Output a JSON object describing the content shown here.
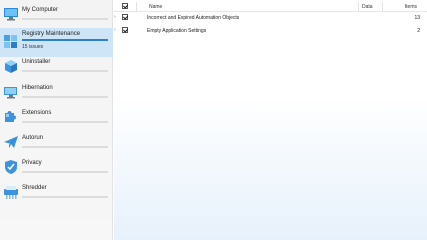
{
  "sidebar": {
    "items": [
      {
        "label": "My Computer",
        "icon": "computer-icon"
      },
      {
        "label": "Registry Maintenance",
        "icon": "registry-cubes-icon",
        "sub": "15 issues"
      },
      {
        "label": "Uninstaller",
        "icon": "uninstaller-box-icon"
      },
      {
        "label": "Hibernation",
        "icon": "hibernation-monitor-icon"
      },
      {
        "label": "Extensions",
        "icon": "puzzle-icon"
      },
      {
        "label": "Autorun",
        "icon": "paper-plane-icon"
      },
      {
        "label": "Privacy",
        "icon": "shield-icon"
      },
      {
        "label": "Shredder",
        "icon": "shredder-icon"
      }
    ]
  },
  "table": {
    "columns": {
      "name": "Name",
      "data": "Data",
      "items": "Items"
    },
    "rows": [
      {
        "name": "Incorrect and Expired Automation Objects",
        "items": "13"
      },
      {
        "name": "Empty Application Settings",
        "items": "2"
      }
    ]
  },
  "colors": {
    "accent": "#2f7fd0",
    "active_bg": "#cde5f7"
  }
}
